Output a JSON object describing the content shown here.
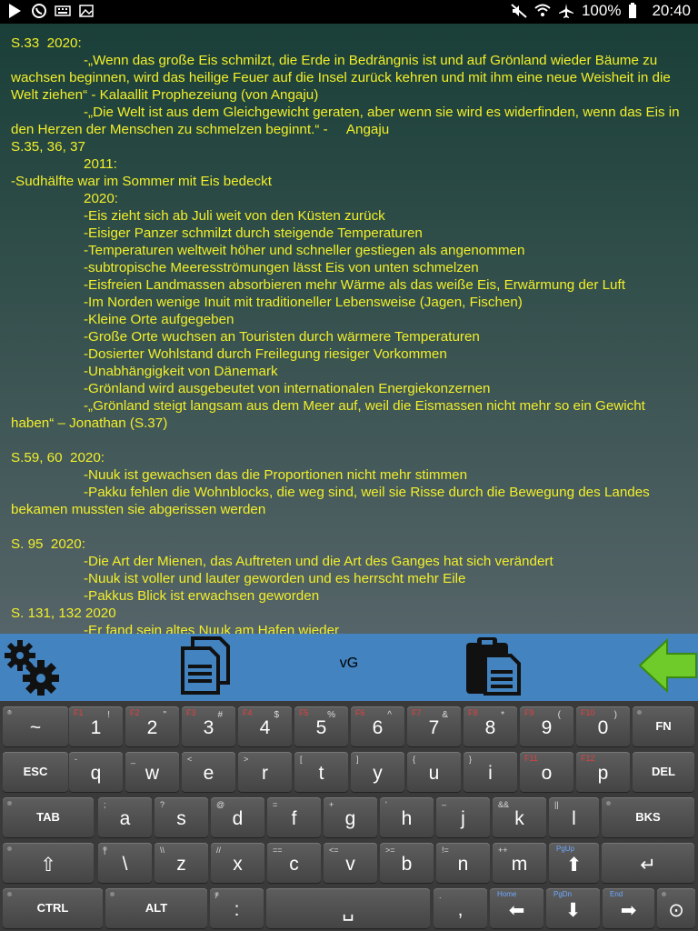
{
  "status_bar": {
    "battery": "100%",
    "time": "20:40"
  },
  "document": {
    "lines": [
      {
        "cls": "",
        "text": "S.33  2020:"
      },
      {
        "cls": "hang",
        "text": "-„Wenn das große Eis schmilzt, die Erde in Bedrängnis ist und auf Grönland wieder Bäume zu wachsen beginnen, wird das heilige Feuer auf die Insel zurück kehren und mit ihm eine neue Weisheit in die Welt ziehen“ - Kalaallit Prophezeiung (von Angaju)"
      },
      {
        "cls": "hang",
        "text": "-„Die Welt ist aus dem Gleichgewicht geraten, aber wenn sie wird es widerfinden, wenn das Eis in den Herzen der Menschen zu schmelzen beginnt.“ -     Angaju"
      },
      {
        "cls": "",
        "text": "S.35, 36, 37"
      },
      {
        "cls": "in",
        "text": "2011:"
      },
      {
        "cls": "",
        "text": "-Sudhälfte war im Sommer mit Eis bedeckt"
      },
      {
        "cls": "in",
        "text": "2020:"
      },
      {
        "cls": "in",
        "text": "-Eis zieht sich ab Juli weit von den Küsten zurück"
      },
      {
        "cls": "in",
        "text": "-Eisiger Panzer schmilzt durch steigende Temperaturen"
      },
      {
        "cls": "in",
        "text": "-Temperaturen weltweit höher und schneller gestiegen als angenommen"
      },
      {
        "cls": "in",
        "text": "-subtropische Meeresströmungen lässt Eis von unten schmelzen"
      },
      {
        "cls": "in",
        "text": "-Eisfreien Landmassen absorbieren mehr Wärme als das weiße Eis, Erwärmung der Luft"
      },
      {
        "cls": "in",
        "text": "-Im Norden wenige Inuit mit traditioneller Lebensweise (Jagen, Fischen)"
      },
      {
        "cls": "in",
        "text": "-Kleine Orte aufgegeben"
      },
      {
        "cls": "in",
        "text": "-Große Orte wuchsen an Touristen durch wärmere Temperaturen"
      },
      {
        "cls": "in",
        "text": "-Dosierter Wohlstand durch Freilegung riesiger Vorkommen"
      },
      {
        "cls": "in",
        "text": "-Unabhängigkeit von Dänemark"
      },
      {
        "cls": "in",
        "text": "-Grönland wird ausgebeutet von internationalen Energiekonzernen"
      },
      {
        "cls": "hang",
        "text": "-„Grönland steigt langsam aus dem Meer auf, weil die Eismassen nicht mehr so ein Gewicht haben“ – Jonathan (S.37)"
      },
      {
        "cls": "",
        "text": " "
      },
      {
        "cls": "",
        "text": "S.59, 60  2020:"
      },
      {
        "cls": "in",
        "text": "-Nuuk ist gewachsen das die Proportionen nicht mehr stimmen"
      },
      {
        "cls": "hang",
        "text": "-Pakku fehlen die Wohnblocks, die weg sind, weil sie Risse durch die Bewegung des Landes bekamen mussten sie abgerissen werden"
      },
      {
        "cls": "",
        "text": " "
      },
      {
        "cls": "",
        "text": "S. 95  2020:"
      },
      {
        "cls": "in",
        "text": "-Die Art der Mienen, das Auftreten und die Art des Ganges hat sich verändert"
      },
      {
        "cls": "in",
        "text": "-Nuuk ist voller und lauter geworden und es herrscht mehr Eile"
      },
      {
        "cls": "in",
        "text": "-Pakkus Blick ist erwachsen geworden"
      },
      {
        "cls": "",
        "text": "S. 131, 132 2020"
      },
      {
        "cls": "in",
        "text": "-Er fand sein altes Nuuk am Hafen wieder"
      }
    ]
  },
  "toolbar": {
    "center_label": "vG"
  },
  "keyboard": {
    "rows": [
      [
        {
          "id": "tilde",
          "main": "~",
          "sub": "`",
          "fn": ""
        },
        {
          "id": "1",
          "main": "1",
          "sub": "!",
          "fn": "F1"
        },
        {
          "id": "2",
          "main": "2",
          "sub": "\"",
          "fn": "F2"
        },
        {
          "id": "3",
          "main": "3",
          "sub": "#",
          "fn": "F3"
        },
        {
          "id": "4",
          "main": "4",
          "sub": "$",
          "fn": "F4"
        },
        {
          "id": "5",
          "main": "5",
          "sub": "%",
          "fn": "F5"
        },
        {
          "id": "6",
          "main": "6",
          "sub": "^",
          "fn": "F6"
        },
        {
          "id": "7",
          "main": "7",
          "sub": "&",
          "fn": "F7"
        },
        {
          "id": "8",
          "main": "8",
          "sub": "*",
          "fn": "F8"
        },
        {
          "id": "9",
          "main": "9",
          "sub": "(",
          "fn": "F9"
        },
        {
          "id": "0",
          "main": "0",
          "sub": ")",
          "fn": "F10"
        },
        {
          "id": "fn",
          "main": "FN",
          "sub": "",
          "fn": ""
        }
      ],
      [
        {
          "id": "esc",
          "main": "ESC",
          "sub": "",
          "fn": ""
        },
        {
          "id": "q",
          "main": "q",
          "sub": "-",
          "fn": ""
        },
        {
          "id": "w",
          "main": "w",
          "sub": "_",
          "fn": ""
        },
        {
          "id": "e",
          "main": "e",
          "sub": "<",
          "fn": ""
        },
        {
          "id": "r",
          "main": "r",
          "sub": ">",
          "fn": ""
        },
        {
          "id": "t",
          "main": "t",
          "sub": "[",
          "fn": ""
        },
        {
          "id": "y",
          "main": "y",
          "sub": "]",
          "fn": ""
        },
        {
          "id": "u",
          "main": "u",
          "sub": "{",
          "fn": ""
        },
        {
          "id": "i",
          "main": "i",
          "sub": "}",
          "fn": ""
        },
        {
          "id": "o",
          "main": "o",
          "sub": "",
          "fn": "F11"
        },
        {
          "id": "p",
          "main": "p",
          "sub": "",
          "fn": "F12"
        },
        {
          "id": "del",
          "main": "DEL",
          "sub": "",
          "fn": ""
        }
      ],
      [
        {
          "id": "tab",
          "main": "TAB",
          "sub": "",
          "fn": ""
        },
        {
          "id": "a",
          "main": "a",
          "sub": ";",
          "fn": ""
        },
        {
          "id": "s",
          "main": "s",
          "sub": "?",
          "fn": ""
        },
        {
          "id": "d",
          "main": "d",
          "sub": "@",
          "fn": ""
        },
        {
          "id": "f",
          "main": "f",
          "sub": "=",
          "fn": ""
        },
        {
          "id": "g",
          "main": "g",
          "sub": "+",
          "fn": ""
        },
        {
          "id": "h",
          "main": "h",
          "sub": "'",
          "fn": ""
        },
        {
          "id": "j",
          "main": "j",
          "sub": "–",
          "fn": ""
        },
        {
          "id": "k",
          "main": "k",
          "sub": "&&",
          "fn": ""
        },
        {
          "id": "l",
          "main": "l",
          "sub": "||",
          "fn": ""
        },
        {
          "id": "bks",
          "main": "BKS",
          "sub": "",
          "fn": ""
        }
      ],
      [
        {
          "id": "shift",
          "main": "⇧",
          "sub": "",
          "fn": ""
        },
        {
          "id": "backslash",
          "main": "\\",
          "sub": "|",
          "fn": ""
        },
        {
          "id": "z",
          "main": "z",
          "sub": "\\\\",
          "fn": ""
        },
        {
          "id": "x",
          "main": "x",
          "sub": "//",
          "fn": ""
        },
        {
          "id": "c",
          "main": "c",
          "sub": "==",
          "fn": ""
        },
        {
          "id": "v",
          "main": "v",
          "sub": "<=",
          "fn": ""
        },
        {
          "id": "b",
          "main": "b",
          "sub": ">=",
          "fn": ""
        },
        {
          "id": "n",
          "main": "n",
          "sub": "!=",
          "fn": ""
        },
        {
          "id": "m",
          "main": "m",
          "sub": "++",
          "fn": ""
        },
        {
          "id": "pgup",
          "main": "⬆",
          "sub": "PgUp",
          "fn": ""
        },
        {
          "id": "enter",
          "main": "↵",
          "sub": "",
          "fn": ""
        }
      ],
      [
        {
          "id": "ctrl",
          "main": "CTRL",
          "sub": "",
          "fn": ""
        },
        {
          "id": "alt",
          "main": "ALT",
          "sub": "",
          "fn": ""
        },
        {
          "id": "colon",
          "main": ":",
          "sub": "/",
          "fn": ""
        },
        {
          "id": "space",
          "main": "␣",
          "sub": "",
          "fn": ""
        },
        {
          "id": "comma",
          "main": ",",
          "sub": ".",
          "fn": ""
        },
        {
          "id": "left",
          "main": "⬅",
          "sub": "Home",
          "fn": ""
        },
        {
          "id": "down",
          "main": "⬇",
          "sub": "PgDn",
          "fn": ""
        },
        {
          "id": "right",
          "main": "➡",
          "sub": "End",
          "fn": ""
        },
        {
          "id": "settings",
          "main": "⊙",
          "sub": "",
          "fn": ""
        }
      ]
    ]
  }
}
